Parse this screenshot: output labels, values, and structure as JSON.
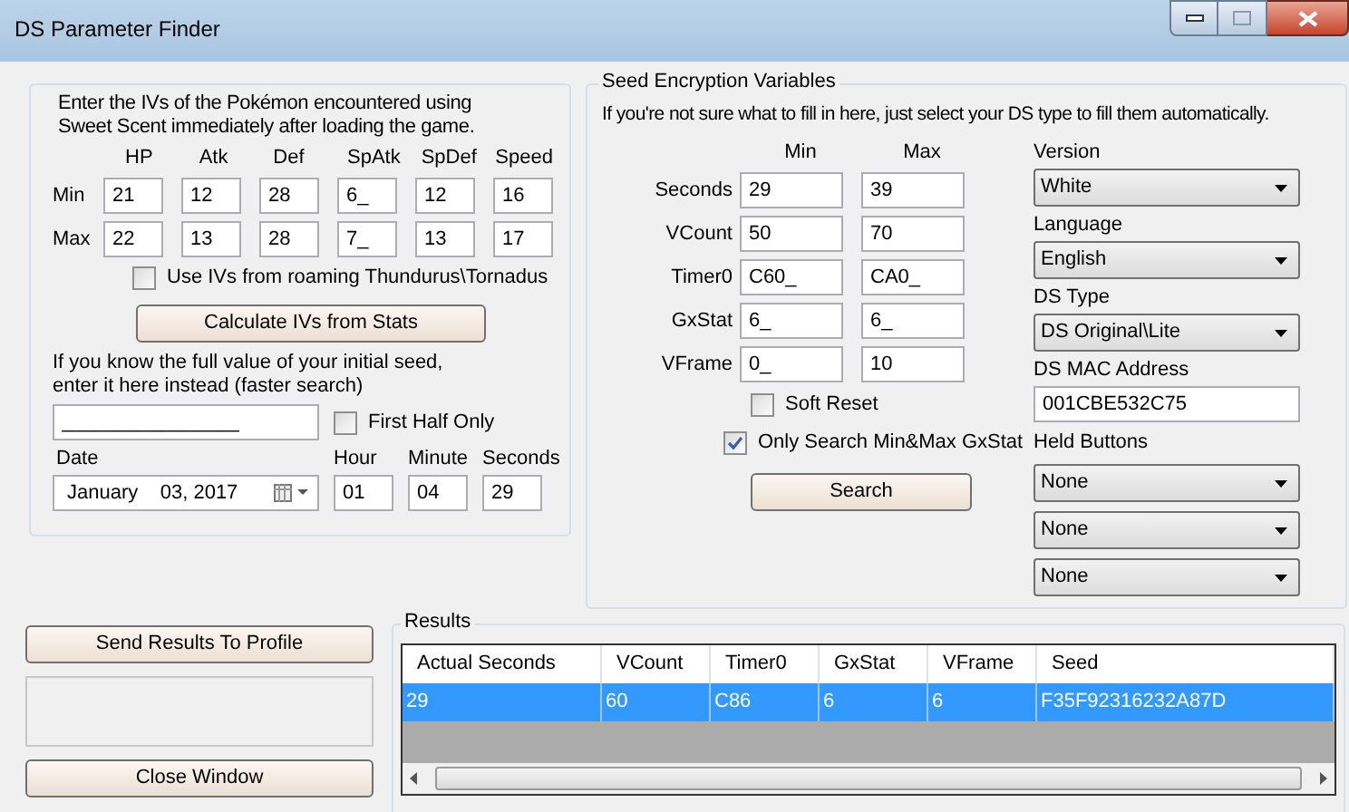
{
  "window": {
    "title": "DS Parameter Finder"
  },
  "iv_panel": {
    "instructions": "Enter the IVs of the Pokémon encountered using Sweet Scent immediately after loading the game.",
    "stat_columns": [
      "HP",
      "Atk",
      "Def",
      "SpAtk",
      "SpDef",
      "Speed"
    ],
    "rows": [
      {
        "label": "Min",
        "values": [
          "21",
          "12",
          "28",
          "6_",
          "12",
          "16"
        ]
      },
      {
        "label": "Max",
        "values": [
          "22",
          "13",
          "28",
          "7_",
          "13",
          "17"
        ]
      }
    ],
    "roaming": {
      "label": "Use IVs from roaming Thundurus\\Tornadus",
      "checked": false
    },
    "calc_button": "Calculate IVs from Stats",
    "seed_hint": "If you know the full value of your initial seed, enter it here instead (faster search)",
    "seed_value": "________________",
    "first_half": {
      "label": "First Half Only",
      "checked": false
    },
    "date": {
      "label": "Date",
      "value": "January    03, 2017"
    },
    "time_fields": [
      {
        "label": "Hour",
        "value": "01"
      },
      {
        "label": "Minute",
        "value": "04"
      },
      {
        "label": "Seconds",
        "value": "29"
      }
    ]
  },
  "seed_panel": {
    "title": "Seed Encryption Variables",
    "hint": "If you're not sure what to fill in here, just select your DS type to fill them automatically.",
    "headers": [
      "Min",
      "Max"
    ],
    "rows": [
      {
        "label": "Seconds",
        "min": "29",
        "max": "39"
      },
      {
        "label": "VCount",
        "min": "50",
        "max": "70"
      },
      {
        "label": "Timer0",
        "min": "C60_",
        "max": "CA0_"
      },
      {
        "label": "GxStat",
        "min": "6_",
        "max": "6_"
      },
      {
        "label": "VFrame",
        "min": "0_",
        "max": "10"
      }
    ],
    "soft_reset": {
      "label": "Soft Reset",
      "checked": false
    },
    "only_gxstat": {
      "label": "Only Search Min&Max GxStat",
      "checked": true
    },
    "search_button": "Search",
    "version": {
      "label": "Version",
      "value": "White"
    },
    "language": {
      "label": "Language",
      "value": "English"
    },
    "ds_type": {
      "label": "DS Type",
      "value": "DS Original\\Lite"
    },
    "mac": {
      "label": "DS MAC Address",
      "value": "001CBE532C75"
    },
    "held_buttons": {
      "label": "Held Buttons",
      "values": [
        "None",
        "None",
        "None"
      ]
    }
  },
  "send_button": "Send Results To Profile",
  "close_button": "Close Window",
  "results": {
    "title": "Results",
    "columns": [
      "Actual Seconds",
      "VCount",
      "Timer0",
      "GxStat",
      "VFrame",
      "Seed"
    ],
    "rows": [
      {
        "cells": [
          "29",
          "60",
          "C86",
          "6",
          "6",
          "F35F92316232A87D"
        ],
        "selected": true
      }
    ]
  }
}
